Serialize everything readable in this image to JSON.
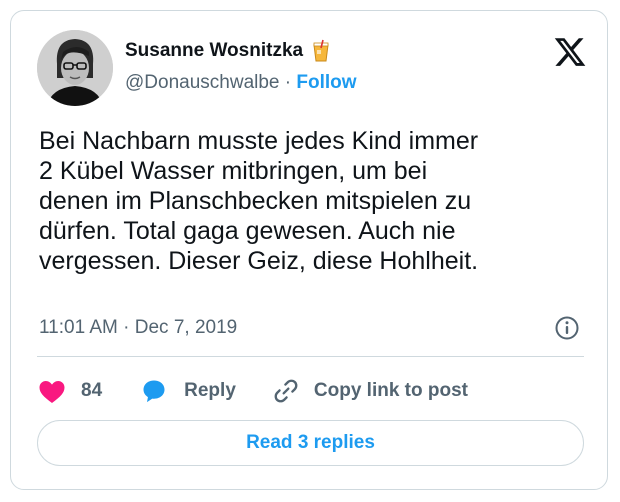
{
  "author": {
    "name": "Susanne Wosnitzka",
    "handle": "@Donauschwalbe",
    "separator": "·",
    "follow_label": "Follow",
    "emoji_icon": "beverage-glass-icon"
  },
  "tweet": {
    "text": "Bei Nachbarn musste jedes Kind immer\n2 Kübel Wasser mitbringen, um bei\ndenen im Planschbecken mitspielen zu\ndürfen. Total gaga gewesen. Auch nie\nvergessen. Dieser Geiz, diese Hohlheit.",
    "time": "11:01 AM",
    "separator": "·",
    "date": "Dec 7, 2019"
  },
  "actions": {
    "like_count": "84",
    "reply_label": "Reply",
    "copy_label": "Copy link to post"
  },
  "footer": {
    "read_replies_label": "Read 3 replies"
  },
  "colors": {
    "accent": "#1d9bf0",
    "like": "#f91880",
    "muted": "#536471",
    "border": "#cfd9de"
  }
}
